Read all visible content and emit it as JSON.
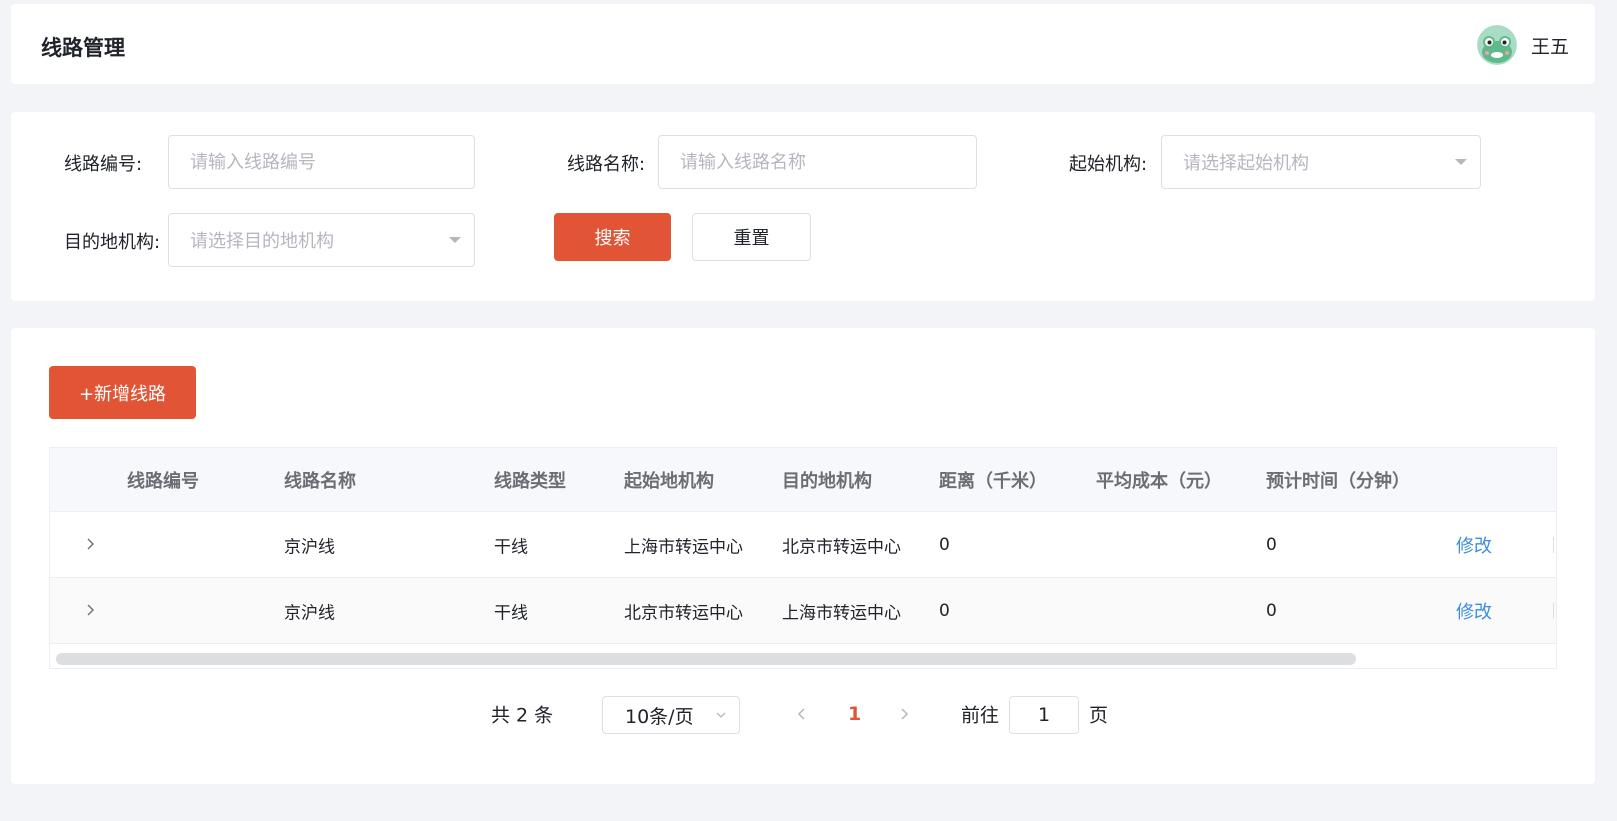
{
  "header": {
    "title": "线路管理",
    "user_name": "王五"
  },
  "search": {
    "line_code_label": "线路编号:",
    "line_code_placeholder": "请输入线路编号",
    "line_name_label": "线路名称:",
    "line_name_placeholder": "请输入线路名称",
    "origin_org_label": "起始机构:",
    "origin_org_placeholder": "请选择起始机构",
    "dest_org_label": "目的地机构:",
    "dest_org_placeholder": "请选择目的地机构",
    "search_label": "搜索",
    "reset_label": "重置"
  },
  "toolbar": {
    "add_label": "+新增线路"
  },
  "table": {
    "columns": [
      "线路编号",
      "线路名称",
      "线路类型",
      "起始地机构",
      "目的地机构",
      "距离（千米）",
      "平均成本（元）",
      "预计时间（分钟）"
    ],
    "rows": [
      {
        "code": "",
        "name": "京沪线",
        "type": "干线",
        "origin": "上海市转运中心",
        "dest": "北京市转运中心",
        "distance": "0",
        "cost": "",
        "time": "0",
        "action": "修改"
      },
      {
        "code": "",
        "name": "京沪线",
        "type": "干线",
        "origin": "北京市转运中心",
        "dest": "上海市转运中心",
        "distance": "0",
        "cost": "",
        "time": "0",
        "action": "修改"
      }
    ]
  },
  "pagination": {
    "total_text": "共 2 条",
    "page_size": "10条/页",
    "current_page": "1",
    "goto_label": "前往",
    "goto_value": "1",
    "page_suffix": "页"
  },
  "colors": {
    "primary": "#e15536",
    "link": "#3a8ee6",
    "background": "#f3f4f7"
  }
}
